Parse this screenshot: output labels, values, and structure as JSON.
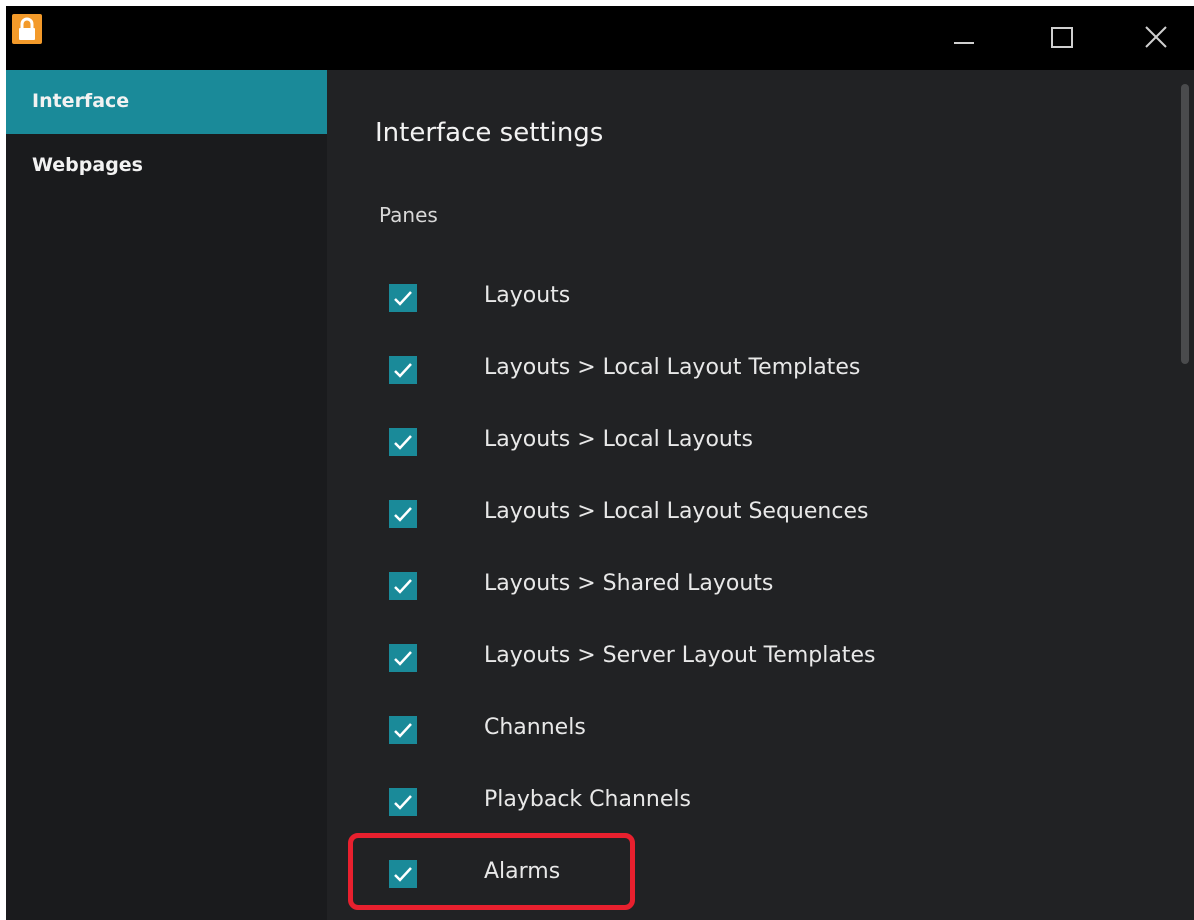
{
  "window": {
    "app_icon": "lock-icon",
    "controls": {
      "minimize_icon": "minimize-icon",
      "maximize_icon": "maximize-icon",
      "close_icon": "close-icon"
    }
  },
  "sidebar": {
    "items": [
      {
        "label": "Interface",
        "active": true
      },
      {
        "label": "Webpages",
        "active": false
      }
    ]
  },
  "main": {
    "title": "Interface settings",
    "section": "Panes",
    "options": [
      {
        "label": "Layouts",
        "checked": true
      },
      {
        "label": "Layouts > Local Layout Templates",
        "checked": true
      },
      {
        "label": "Layouts > Local Layouts",
        "checked": true
      },
      {
        "label": "Layouts > Local Layout Sequences",
        "checked": true
      },
      {
        "label": "Layouts > Shared Layouts",
        "checked": true
      },
      {
        "label": "Layouts > Server Layout Templates",
        "checked": true
      },
      {
        "label": "Channels",
        "checked": true
      },
      {
        "label": "Playback Channels",
        "checked": true
      },
      {
        "label": "Alarms",
        "checked": true
      }
    ]
  },
  "colors": {
    "accent": "#1a8a99",
    "sidebar_bg": "#1a1b1d",
    "main_bg": "#212224",
    "titlebar_bg": "#000000",
    "highlight": "#e8202e",
    "app_icon": "#f39a2a"
  }
}
